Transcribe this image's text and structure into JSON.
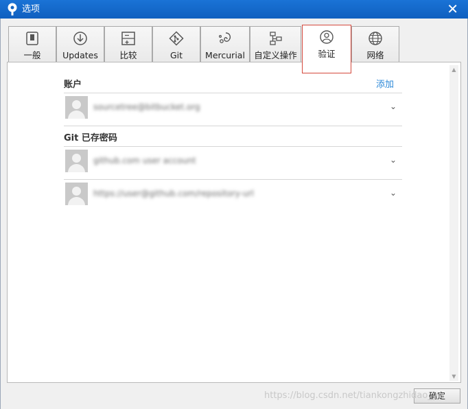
{
  "window": {
    "title": "选项",
    "close_glyph": "✕"
  },
  "tabs": [
    {
      "label": "一般",
      "icon": "switch-icon"
    },
    {
      "label": "Updates",
      "icon": "download-circle-icon"
    },
    {
      "label": "比较",
      "icon": "compare-icon"
    },
    {
      "label": "Git",
      "icon": "git-icon"
    },
    {
      "label": "Mercurial",
      "icon": "mercurial-icon"
    },
    {
      "label": "自定义操作",
      "icon": "custom-actions-icon"
    },
    {
      "label": "验证",
      "icon": "user-circle-icon",
      "active": true
    },
    {
      "label": "网络",
      "icon": "globe-icon"
    }
  ],
  "accounts": {
    "title": "账户",
    "add_label": "添加",
    "items": [
      {
        "text": "sourcetree@bitbucket.org"
      }
    ]
  },
  "git_passwords": {
    "title": "Git 已存密码",
    "items": [
      {
        "text": "github.com user account"
      },
      {
        "text": "https://user@github.com/repository-url"
      }
    ]
  },
  "ok_label": "确定",
  "watermark": "https://blog.csdn.net/tiankongzhidao_ye",
  "colors": {
    "titlebar": "#1565c0",
    "active_tab_border": "#d4473b",
    "link": "#2b88d8"
  }
}
